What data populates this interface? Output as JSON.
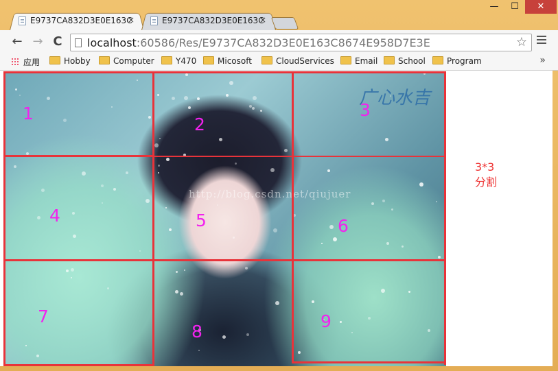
{
  "window": {
    "tabs": [
      {
        "title": "E9737CA832D3E0E163C",
        "close": "×",
        "active": true
      },
      {
        "title": "E9737CA832D3E0E163C",
        "close": "×",
        "active": false
      }
    ],
    "controls": {
      "minimize": "—",
      "maximize": "☐",
      "close": "✕"
    }
  },
  "toolbar": {
    "back": "←",
    "forward": "→",
    "reload": "C",
    "url_host": "localhost",
    "url_path": ":60586/Res/E9737CA832D3E0E163C8674E958D7E3E",
    "star": "☆"
  },
  "bookmarks": {
    "apps_label": "应用",
    "items": [
      "Hobby",
      "Computer",
      "Y470",
      "Micosoft",
      "CloudServices",
      "Email",
      "School",
      "Program"
    ],
    "more": "»"
  },
  "content": {
    "grid_labels": [
      "1",
      "2",
      "3",
      "4",
      "5",
      "6",
      "7",
      "8",
      "9"
    ],
    "side_note_line1": "3*3",
    "side_note_line2": "分割",
    "watermark": "http://blog.csdn.net/qiujuer",
    "logo_text": "广心水吉"
  },
  "colors": {
    "grid_line": "#e8333a",
    "label": "#f222ee",
    "side_note": "#e33333"
  }
}
